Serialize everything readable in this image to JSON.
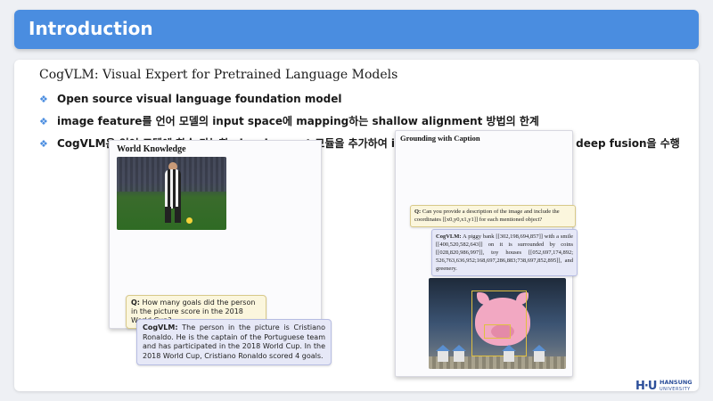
{
  "header": {
    "title": "Introduction"
  },
  "slide": {
    "title": "CogVLM: Visual Expert for Pretrained Language Models",
    "bullets": [
      "Open source visual language foundation model",
      "image feature를 언어 모델의 input space에 mapping하는 shallow alignment 방법의 한계",
      "CogVLM은 언어 모델에 학습 가능한 visual expert 모듈을 추가하여 image feature과 text feature간 deep fusion을 수행"
    ]
  },
  "figure_world_knowledge": {
    "title": "World Knowledge",
    "question_label": "Q:",
    "question": "How many goals did the person in the picture score in the 2018 World Cup?",
    "answer_label": "CogVLM:",
    "answer": "The person in the picture is Cristiano Ronaldo. He is the captain of the Portuguese team and has participated in the 2018 World Cup. In the 2018 World Cup, Cristiano Ronaldo scored 4 goals."
  },
  "figure_grounding": {
    "title": "Grounding with Caption",
    "question_label": "Q:",
    "question": "Can you provide a description of the image and include the coordinates [[x0,y0,x1,y1]] for each mentioned object?",
    "answer_label": "CogVLM:",
    "answer": "A piggy bank [[302,198,694,857]] with a smile [[400,520,582,643]] on it is surrounded by coins [[028,820,986,997]], toy houses [[052,697,174,892; 526,763,636,952;168,697,286,883;738,697,852,895]], and greenery."
  },
  "logo": {
    "mark": "H·U",
    "name": "HANSUNG",
    "sub": "UNIVERSITY"
  },
  "colors": {
    "accent": "#4a8de0",
    "question_bg": "#fbf6dd",
    "answer_bg": "#e6e8f7",
    "brand": "#2c4f9a"
  }
}
